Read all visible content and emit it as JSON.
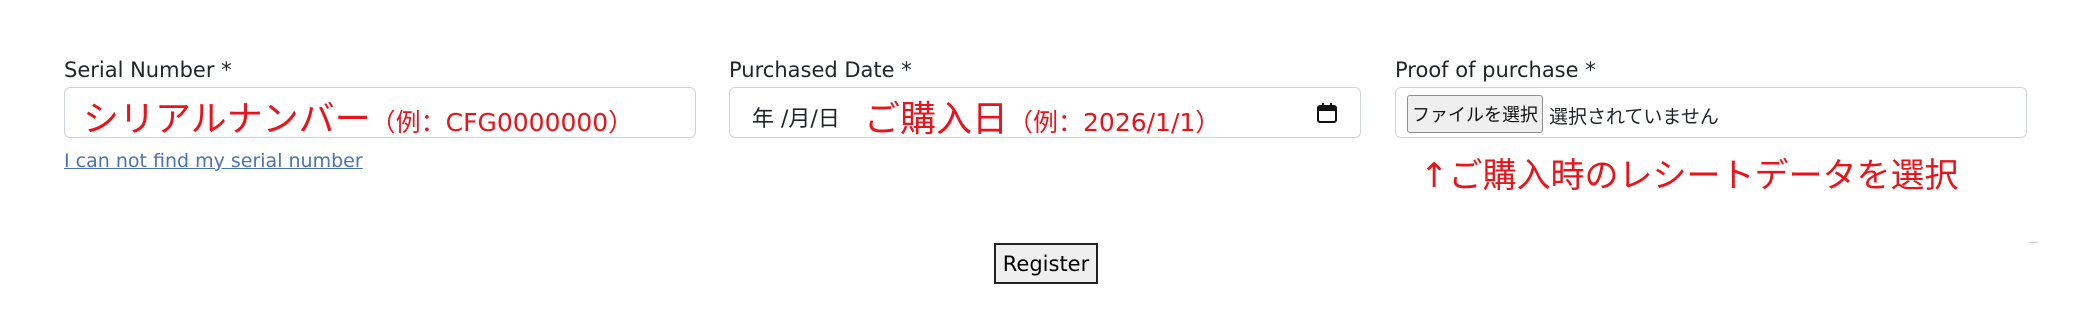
{
  "serial": {
    "label": "Serial Number *",
    "annotation_main": "シリアルナンバー",
    "annotation_example": "（例：CFG0000000）",
    "help_link": "I can not find my serial number"
  },
  "purchase_date": {
    "label": "Purchased Date *",
    "placeholder": "年 /月/日",
    "annotation_main": "ご購入日",
    "annotation_example": "（例：2026/1/1）",
    "icon": "calendar-icon"
  },
  "proof": {
    "label": "Proof of purchase *",
    "button_label": "ファイルを選択",
    "status": "選択されていません",
    "annotation": "↑ご購入時のレシートデータを選択"
  },
  "register_label": "Register",
  "colors": {
    "annotation": "#e8141b",
    "link": "#4a73b5",
    "border": "#ced4da"
  }
}
